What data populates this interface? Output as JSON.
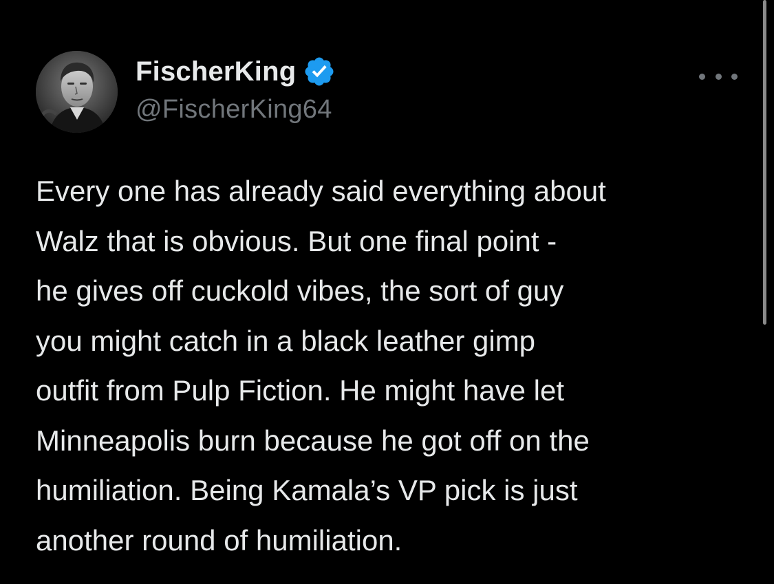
{
  "author": {
    "display_name": "FischerKing",
    "handle": "@FischerKing64",
    "verified": true,
    "avatar_icon": "profile-photo"
  },
  "menu": {
    "more_icon": "more-horizontal-icon"
  },
  "tweet": {
    "text": "Every one has already said everything about\nWalz that is obvious. But one final point -\nhe gives off cuckold vibes, the sort of guy\nyou might catch in a black leather gimp\noutfit from Pulp Fiction. He might have let\nMinneapolis burn because he got off on the\nhumiliation. Being Kamala’s VP pick is just\nanother round of humiliation."
  },
  "colors": {
    "background": "#000000",
    "primary_text": "#e7e9ea",
    "secondary_text": "#71767b",
    "verified_badge": "#1d9bf0"
  }
}
